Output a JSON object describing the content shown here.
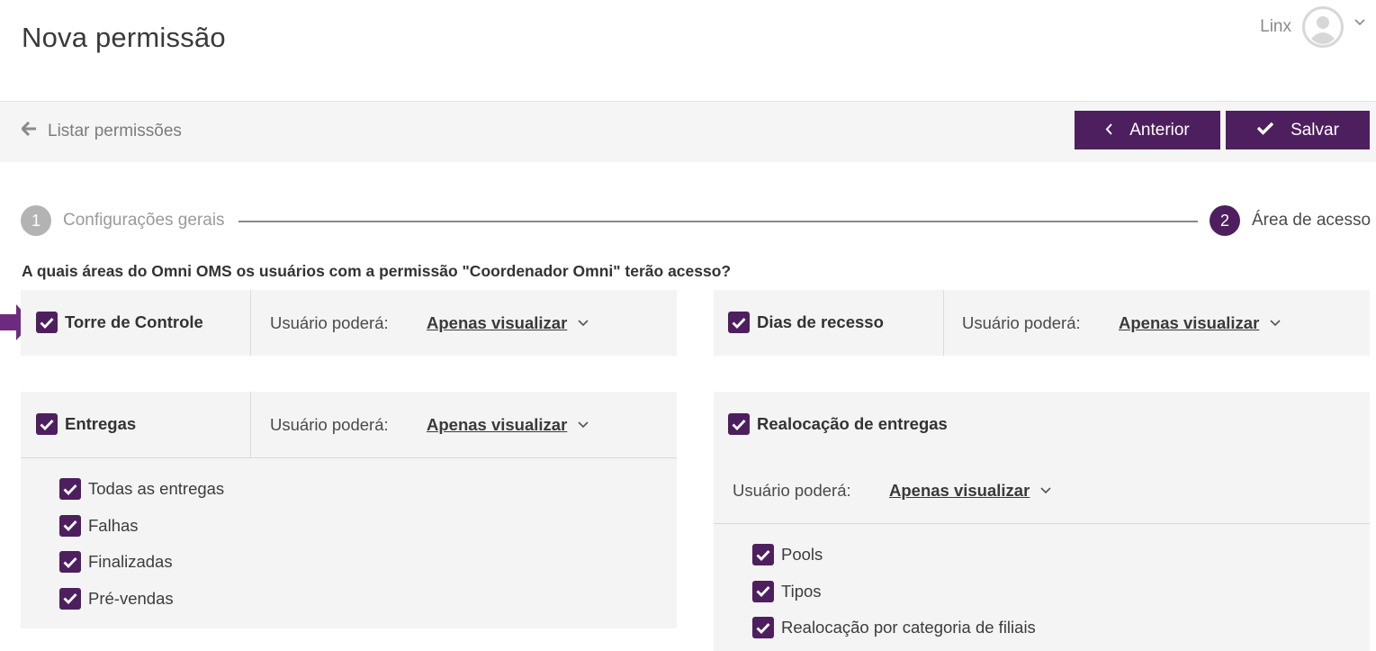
{
  "header": {
    "title": "Nova permissão",
    "user_name": "Linx"
  },
  "toolbar": {
    "back_label": "Listar permissões",
    "prev_label": "Anterior",
    "save_label": "Salvar"
  },
  "stepper": {
    "steps": [
      {
        "number": "1",
        "label": "Configurações gerais",
        "state": "done"
      },
      {
        "number": "2",
        "label": "Área de acesso",
        "state": "active"
      }
    ]
  },
  "question": "A quais áreas do Omni OMS os usuários com a permissão \"Coordenador Omni\" terão acesso?",
  "areas": [
    {
      "name": "Torre de Controle",
      "checked": true,
      "permission_label": "Usuário poderá:",
      "permission_value": "Apenas visualizar",
      "sub_items": []
    },
    {
      "name": "Dias de recesso",
      "checked": true,
      "permission_label": "Usuário poderá:",
      "permission_value": "Apenas visualizar",
      "sub_items": []
    },
    {
      "name": "Entregas",
      "checked": true,
      "permission_label": "Usuário poderá:",
      "permission_value": "Apenas visualizar",
      "sub_items": [
        {
          "label": "Todas as entregas",
          "checked": true
        },
        {
          "label": "Falhas",
          "checked": true
        },
        {
          "label": "Finalizadas",
          "checked": true
        },
        {
          "label": "Pré-vendas",
          "checked": true
        }
      ]
    },
    {
      "name": "Realocação de entregas",
      "checked": true,
      "permission_label": "Usuário poderá:",
      "permission_value": "Apenas visualizar",
      "sub_items": [
        {
          "label": "Pools",
          "checked": true
        },
        {
          "label": "Tipos",
          "checked": true
        },
        {
          "label": "Realocação por categoria de filiais",
          "checked": true
        }
      ]
    }
  ],
  "colors": {
    "accent": "#4e1f5e",
    "panel": "#f4f4f4",
    "toolbar": "#f4f5f4",
    "step_done": "#b3b3b3",
    "arrow": "#6e2a7e"
  },
  "icons": {
    "back": "arrow-left-icon",
    "prev": "chevron-left-icon",
    "save": "check-icon",
    "checkbox": "checkbox-checked-icon",
    "dropdown": "chevron-down-icon",
    "user": "user-avatar-icon"
  }
}
